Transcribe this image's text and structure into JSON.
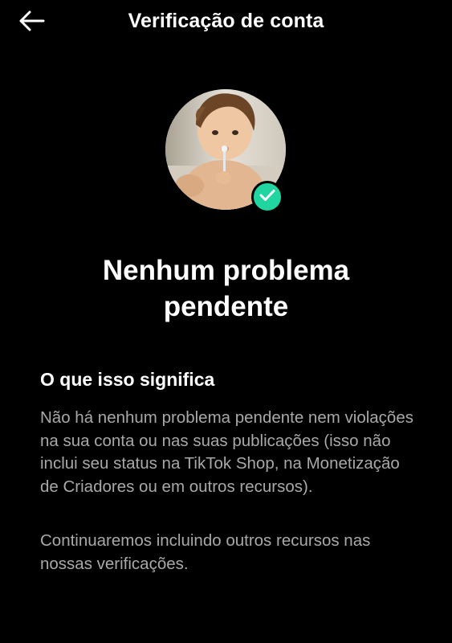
{
  "header": {
    "title": "Verificação de conta",
    "back_icon": "arrow-left-icon"
  },
  "profile": {
    "avatar_description_icon": "avatar-photo",
    "badge_icon": "check-icon",
    "badge_color": "#20d5a0"
  },
  "status": {
    "title": "Nenhum problema pendente"
  },
  "explanation": {
    "heading": "O que isso significa",
    "paragraph_1": "Não há nenhum problema pendente nem violações na sua conta ou nas suas publicações (isso não inclui seu status na TikTok Shop, na Monetização de Criadores ou em outros recursos).",
    "paragraph_2": "Continuaremos incluindo outros recursos nas nossas verificações."
  },
  "colors": {
    "background": "#000000",
    "text_primary": "#ffffff",
    "text_secondary": "#a8a8a8",
    "accent": "#20d5a0"
  }
}
